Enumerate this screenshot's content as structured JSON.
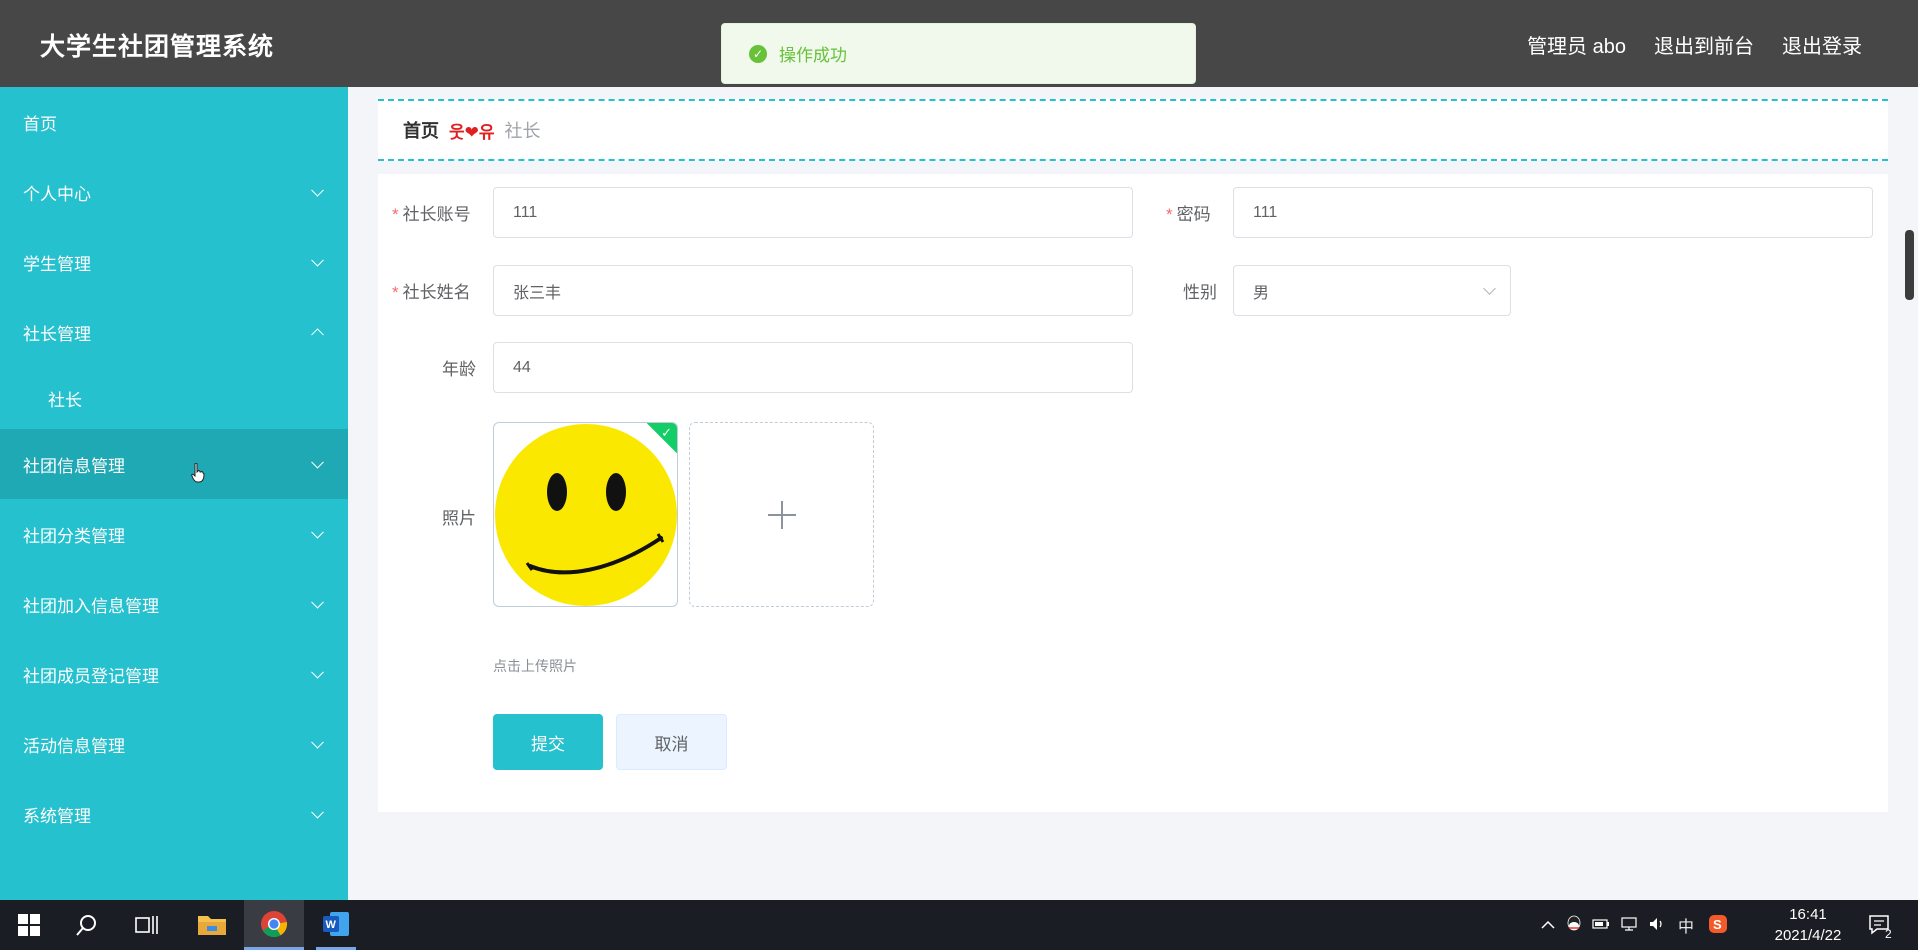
{
  "app": {
    "title": "大学生社团管理系统"
  },
  "header": {
    "admin_label": "管理员 abo",
    "back_front": "退出到前台",
    "logout": "退出登录"
  },
  "toast": {
    "message": "操作成功",
    "type": "success"
  },
  "sidebar": {
    "items": [
      {
        "label": "首页",
        "expandable": false
      },
      {
        "label": "个人中心",
        "expandable": true
      },
      {
        "label": "学生管理",
        "expandable": true
      },
      {
        "label": "社长管理",
        "expandable": true,
        "expanded": true
      },
      {
        "label": "社长",
        "sub": true
      },
      {
        "label": "社团信息管理",
        "expandable": true,
        "active": true
      },
      {
        "label": "社团分类管理",
        "expandable": true
      },
      {
        "label": "社团加入信息管理",
        "expandable": true
      },
      {
        "label": "社团成员登记管理",
        "expandable": true
      },
      {
        "label": "活动信息管理",
        "expandable": true
      },
      {
        "label": "系统管理",
        "expandable": true
      }
    ]
  },
  "breadcrumb": {
    "home": "首页",
    "separator": "웃❤유",
    "current": "社长"
  },
  "form": {
    "account_label": "社长账号",
    "account_value": "111",
    "password_label": "密码",
    "password_value": "111",
    "name_label": "社长姓名",
    "name_value": "张三丰",
    "gender_label": "性别",
    "gender_value": "男",
    "age_label": "年龄",
    "age_value": "44",
    "photo_label": "照片",
    "photo_hint": "点击上传照片",
    "submit_label": "提交",
    "cancel_label": "取消",
    "required_mark": "*",
    "upload_plus": "+"
  },
  "taskbar": {
    "ime": "中",
    "time": "16:41",
    "date": "2021/4/22",
    "notification_count": "2"
  },
  "colors": {
    "accent": "#25c1ce",
    "header": "#474747",
    "success": "#67c23a"
  }
}
